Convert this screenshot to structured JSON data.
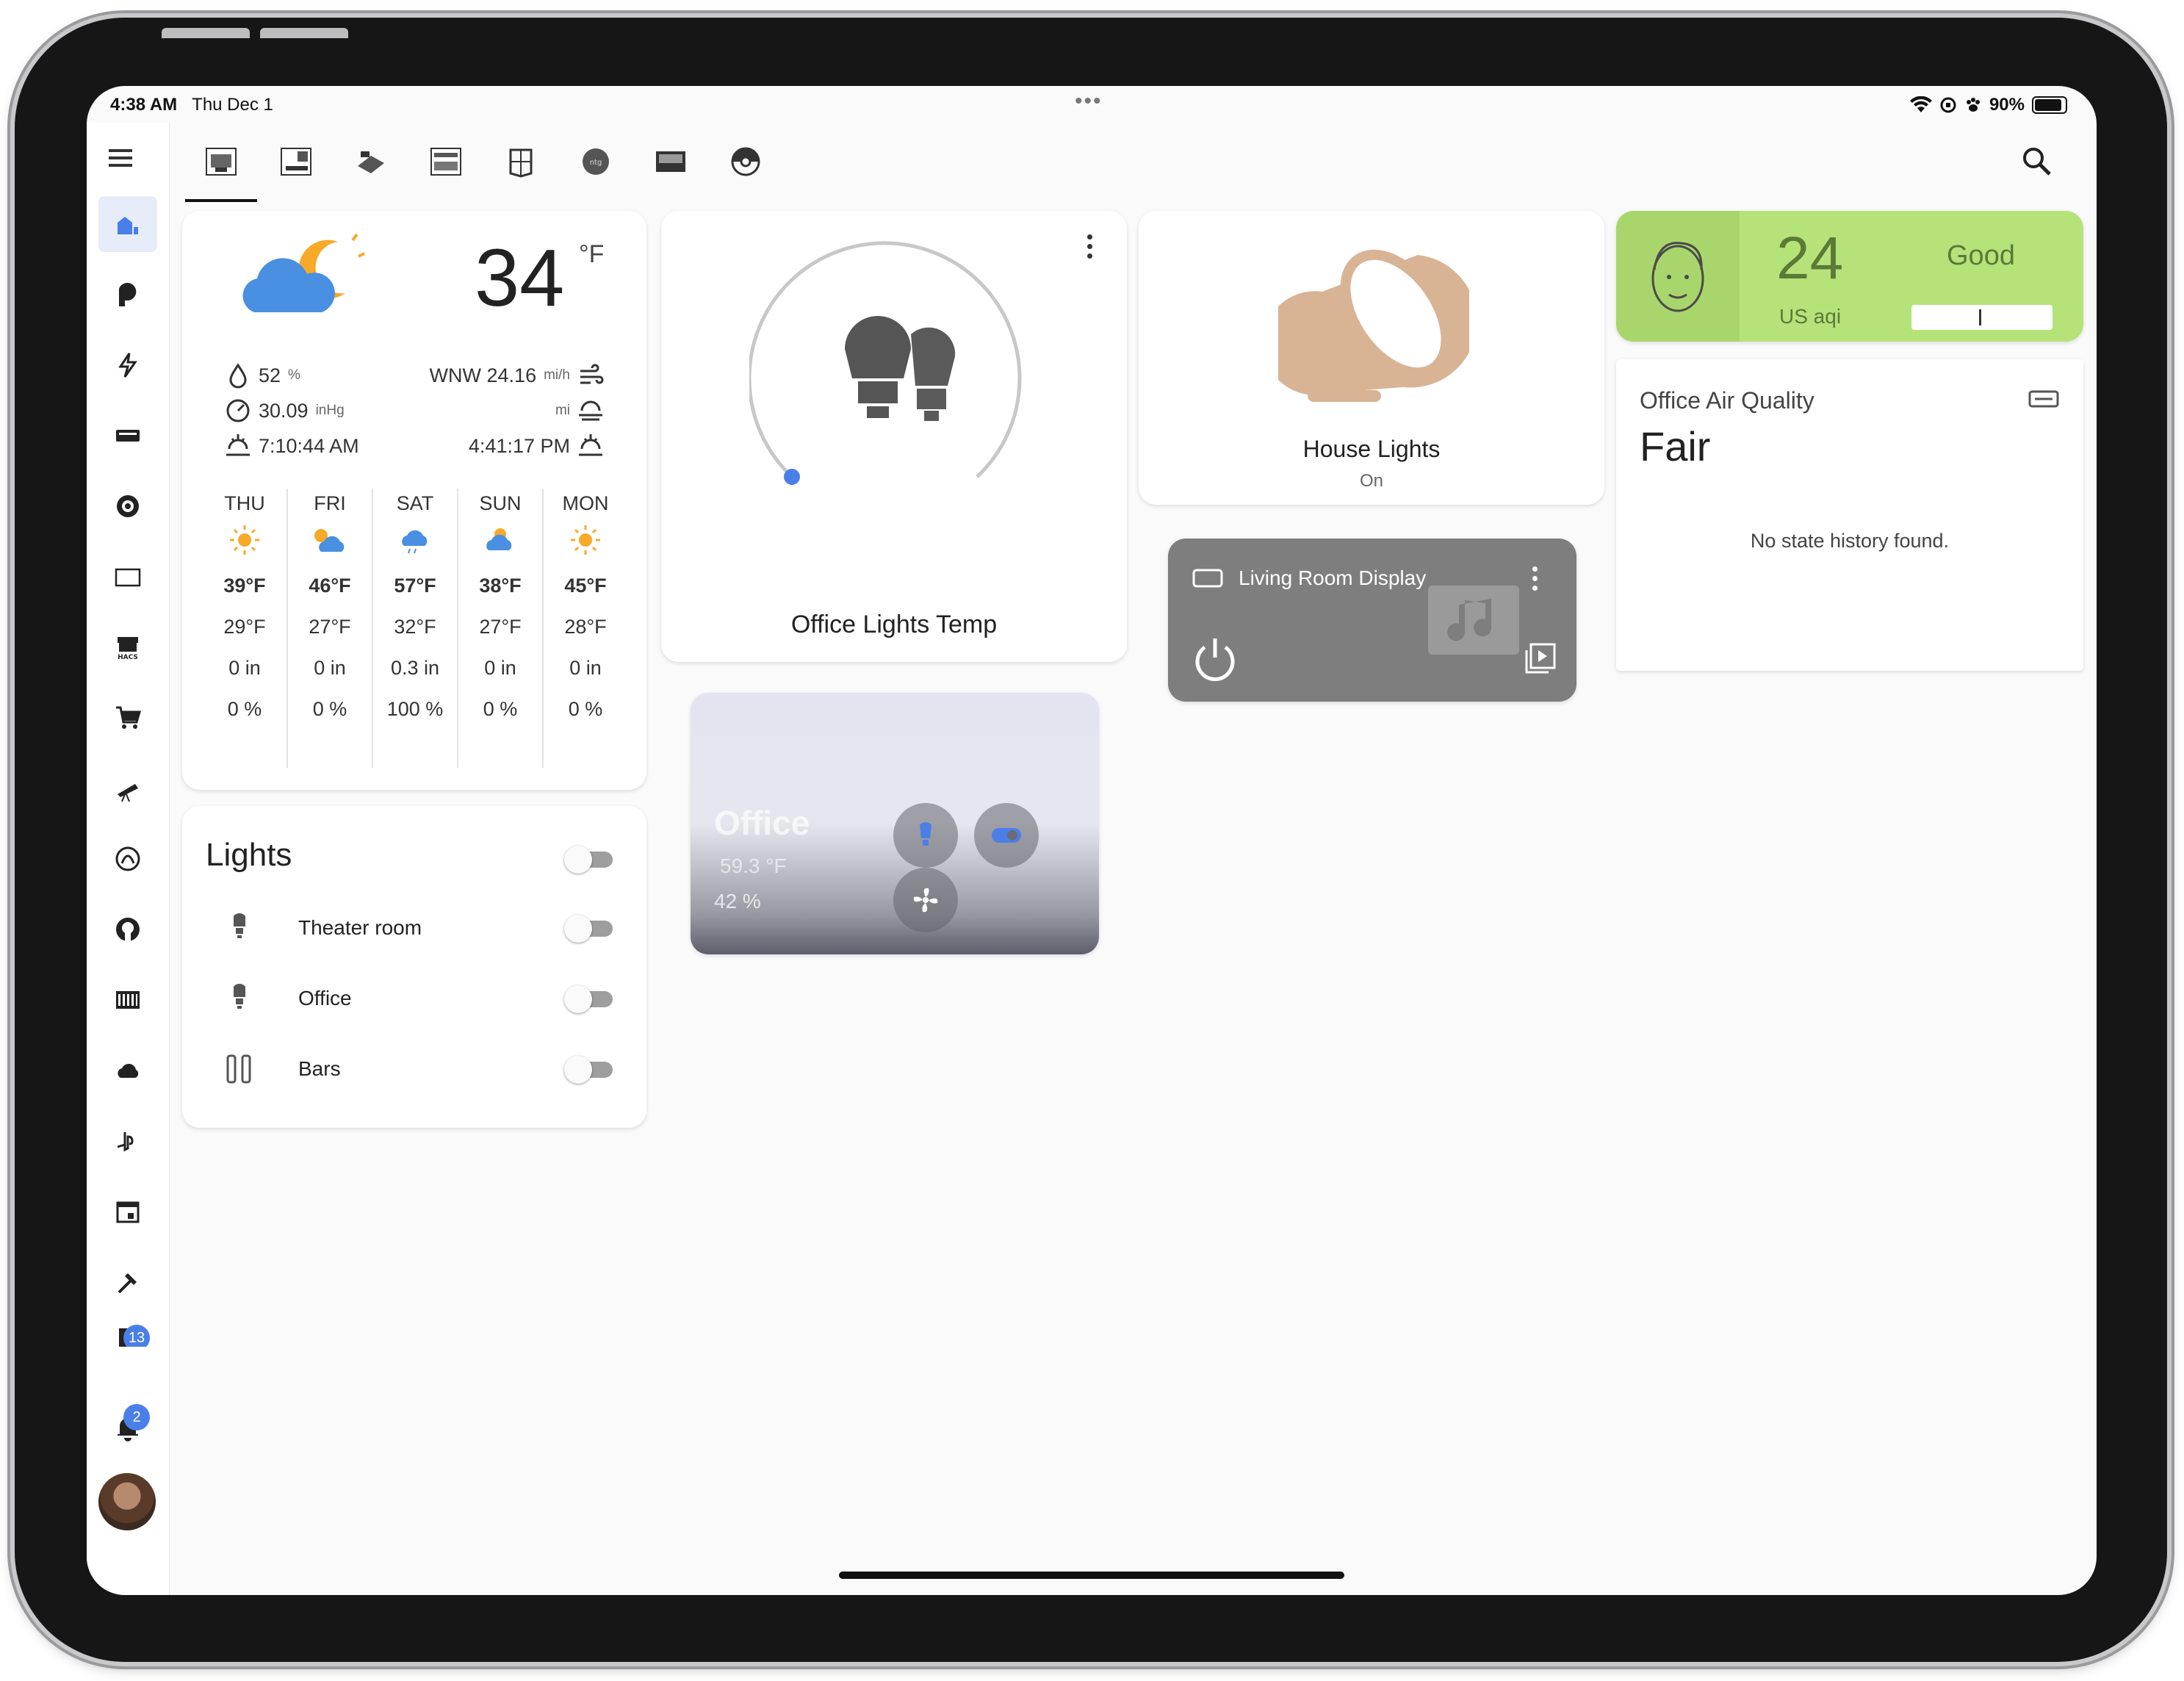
{
  "status": {
    "time": "4:38 AM",
    "date": "Thu Dec 1",
    "battery": "90%"
  },
  "sidebar": {
    "items": [
      "overview-icon",
      "plex-icon",
      "energy-icon",
      "media-icon",
      "target-icon",
      "square-icon",
      "hacs-icon",
      "cart-icon",
      "telescope-icon",
      "octoprint-icon",
      "github-icon",
      "terminal-icon",
      "cloud-icon",
      "playstation-icon",
      "calendar-icon",
      "hammer-icon",
      "developer-icon"
    ],
    "dev_badge": "13",
    "notifications_badge": "2"
  },
  "weather": {
    "temp": "34",
    "unit": "°F",
    "humidity": "52",
    "humidity_unit": "%",
    "pressure": "30.09",
    "pressure_unit": "inHg",
    "sunrise": "7:10:44 AM",
    "wind": "WNW 24.16",
    "wind_unit": "mi/h",
    "visibility_unit": "mi",
    "sunset": "4:41:17 PM",
    "forecast": [
      {
        "day": "THU",
        "hi": "39°F",
        "lo": "29°F",
        "precip": "0 in",
        "chance": "0 %",
        "icon": "sunny"
      },
      {
        "day": "FRI",
        "hi": "46°F",
        "lo": "27°F",
        "precip": "0 in",
        "chance": "0 %",
        "icon": "partly-cloudy"
      },
      {
        "day": "SAT",
        "hi": "57°F",
        "lo": "32°F",
        "precip": "0.3 in",
        "chance": "100 %",
        "icon": "rainy"
      },
      {
        "day": "SUN",
        "hi": "38°F",
        "lo": "27°F",
        "precip": "0 in",
        "chance": "0 %",
        "icon": "partly-cloudy"
      },
      {
        "day": "MON",
        "hi": "45°F",
        "lo": "28°F",
        "precip": "0 in",
        "chance": "0 %",
        "icon": "sunny"
      }
    ]
  },
  "lights": {
    "title": "Lights",
    "items": [
      {
        "label": "Theater room",
        "icon": "bulb-icon"
      },
      {
        "label": "Office",
        "icon": "bulb-icon"
      },
      {
        "label": "Bars",
        "icon": "bars-icon"
      }
    ]
  },
  "office_lights_temp": {
    "title": "Office Lights Temp"
  },
  "office": {
    "name": "Office",
    "temp": "59.3 °F",
    "humidity": "42 %"
  },
  "house_lights": {
    "title": "House Lights",
    "state": "On"
  },
  "living_room": {
    "title": "Living Room Display"
  },
  "aqi": {
    "value": "24",
    "unit": "US aqi",
    "status": "Good"
  },
  "air_quality": {
    "title": "Office Air Quality",
    "state": "Fair",
    "history": "No state history found."
  },
  "colors": {
    "accent": "#4a7fe8",
    "aqi_bg": "#b5e37a",
    "bulb_tan": "#d8b495",
    "sun": "#f7a928"
  }
}
